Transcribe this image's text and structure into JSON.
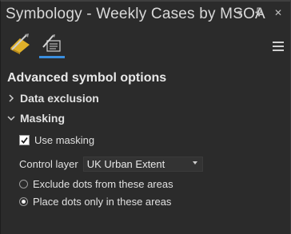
{
  "window": {
    "title": "Symbology - Weekly Cases by MSOA",
    "controls": {
      "menu_icon": "dropdown-arrow-icon",
      "pin_icon": "pin-icon",
      "close_icon": "close-icon",
      "menu_glyph": "▾",
      "pin_glyph": "⊥",
      "close_glyph": "✕"
    }
  },
  "tabs": [
    {
      "name": "primary-symbology-tab",
      "icon": "brush-icon",
      "active": false
    },
    {
      "name": "symbology-options-tab",
      "icon": "dot-density-options-icon",
      "active": true
    }
  ],
  "heading": "Advanced symbol options",
  "sections": {
    "data_exclusion": {
      "label": "Data exclusion",
      "expanded": false,
      "chevron": "›"
    },
    "masking": {
      "label": "Masking",
      "expanded": true,
      "chevron": "⌄"
    }
  },
  "masking": {
    "use_masking_label": "Use masking",
    "use_masking_checked": true,
    "check_glyph": "✓",
    "control_layer_label": "Control layer",
    "control_layer_value": "UK Urban Extent",
    "options": [
      {
        "label": "Exclude dots from these areas",
        "selected": false
      },
      {
        "label": "Place dots only in these areas",
        "selected": true
      }
    ]
  },
  "colors": {
    "background": "#2b2b2b",
    "accent": "#3a8fe0",
    "text": "#e0e0e0"
  }
}
